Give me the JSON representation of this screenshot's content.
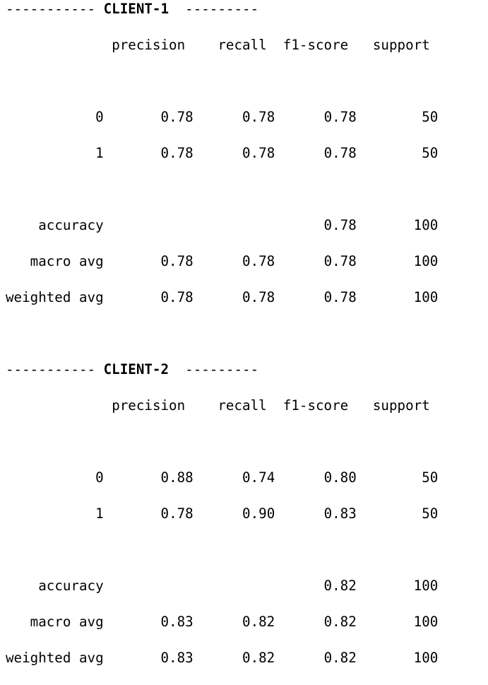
{
  "reports": [
    {
      "title": "CLIENT-1",
      "headers": [
        "precision",
        "recall",
        "f1-score",
        "support"
      ],
      "rows": [
        {
          "label": "0",
          "precision": "0.78",
          "recall": "0.78",
          "f1": "0.78",
          "support": "50"
        },
        {
          "label": "1",
          "precision": "0.78",
          "recall": "0.78",
          "f1": "0.78",
          "support": "50"
        },
        {
          "label": "accuracy",
          "precision": "",
          "recall": "",
          "f1": "0.78",
          "support": "100"
        },
        {
          "label": "macro avg",
          "precision": "0.78",
          "recall": "0.78",
          "f1": "0.78",
          "support": "100"
        },
        {
          "label": "weighted avg",
          "precision": "0.78",
          "recall": "0.78",
          "f1": "0.78",
          "support": "100"
        }
      ]
    },
    {
      "title": "CLIENT-2",
      "headers": [
        "precision",
        "recall",
        "f1-score",
        "support"
      ],
      "rows": [
        {
          "label": "0",
          "precision": "0.88",
          "recall": "0.74",
          "f1": "0.80",
          "support": "50"
        },
        {
          "label": "1",
          "precision": "0.78",
          "recall": "0.90",
          "f1": "0.83",
          "support": "50"
        },
        {
          "label": "accuracy",
          "precision": "",
          "recall": "",
          "f1": "0.82",
          "support": "100"
        },
        {
          "label": "macro avg",
          "precision": "0.83",
          "recall": "0.82",
          "f1": "0.82",
          "support": "100"
        },
        {
          "label": "weighted avg",
          "precision": "0.83",
          "recall": "0.82",
          "f1": "0.82",
          "support": "100"
        }
      ]
    }
  ]
}
